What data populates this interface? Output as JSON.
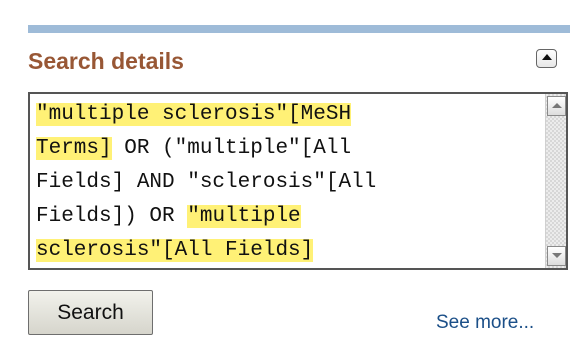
{
  "panel": {
    "title": "Search details",
    "collapse_icon": "triangle-up-icon"
  },
  "query": {
    "lines": [
      {
        "segments": [
          {
            "text": "\"multiple sclerosis\"[MeSH",
            "highlight": true
          }
        ]
      },
      {
        "segments": [
          {
            "text": "Terms]",
            "highlight": true
          },
          {
            "text": " OR (\"multiple\"[All",
            "highlight": false
          }
        ]
      },
      {
        "segments": [
          {
            "text": "Fields] AND \"sclerosis\"[All",
            "highlight": false
          }
        ]
      },
      {
        "segments": [
          {
            "text": "Fields]) OR ",
            "highlight": false
          },
          {
            "text": "\"multiple",
            "highlight": true
          }
        ]
      },
      {
        "segments": [
          {
            "text": "sclerosis\"[All Fields]",
            "highlight": true
          }
        ]
      }
    ],
    "scroll_up_icon": "scroll-up-arrow-icon",
    "scroll_down_icon": "scroll-down-arrow-icon"
  },
  "actions": {
    "search_label": "Search",
    "see_more_label": "See more..."
  },
  "colors": {
    "title": "#985735",
    "top_bar": "#9ebbd8",
    "highlight": "#fff176",
    "link": "#1b4f88"
  }
}
